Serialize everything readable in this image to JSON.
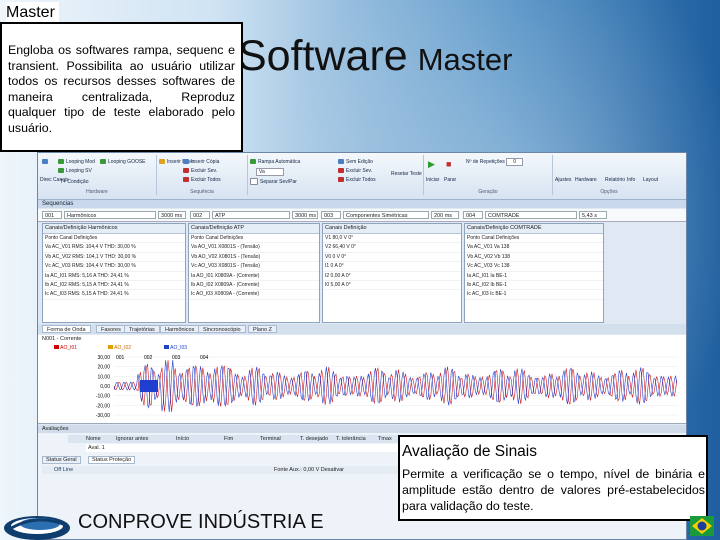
{
  "slide": {
    "title_main": "Software",
    "title_secondary": "Master"
  },
  "callout_master": {
    "heading": "Master",
    "body": "Engloba os softwares rampa, sequenc e transient. Possibilita ao usuário utilizar todos os recursos desses softwares de maneira centralizada, Reproduz qualquer tipo de teste elaborado pelo usuário."
  },
  "callout_avaliacao": {
    "heading": "Avaliação de Sinais",
    "body": "Permite a verificação se o tempo, nível de binária e amplitude estão dentro de valores pré-estabelecidos para validação do teste."
  },
  "footer": {
    "company": "CONPROVE INDÚSTRIA E"
  },
  "screenshot": {
    "ribbon": {
      "btn_looping1": "Looping Mod",
      "btn_looping2": "Looping GOOSE",
      "btn_looping3": "Looping SV",
      "btn_sinal": "Sinal Constante",
      "btn_direc": "Direc Canais",
      "btn_tabela": "T+ Condição",
      "btn_inserir": "Inserir Novo",
      "btn_inserir_copia": "Inserir Cópia",
      "btn_excluir_sev": "Excluir Sev.",
      "btn_excluir_todos": "Excluir Todos",
      "btn_rampa": "Rampa Automática",
      "btn_va": "Va",
      "btn_separar": "Separar Sev/Par",
      "btn_sem_edicao": "Sem Edição",
      "btn_excluir_sev2": "Excluir Sev.",
      "btn_excluir_todos2": "Excluir Todos",
      "btn_resetar": "Resetar Teste",
      "btn_iniciar": "Iniciar",
      "btn_parar": "Parar",
      "repeticoes_label": "Nº de Repetições",
      "repeticoes_value": "0",
      "btn_ajustes": "Ajustes",
      "btn_hardware": "Hardware",
      "btn_relatorio": "Relatório",
      "btn_info": "Info",
      "btn_layout": "Layout",
      "grp_hardware": "Hardware",
      "grp_sequencia": "Sequência",
      "grp_geracao": "Geração",
      "grp_opcoes": "Opções"
    },
    "tab_sequencias": "Sequencias",
    "seq": {
      "c1": "001",
      "c2": "Harmônicos",
      "c3": "3000 ms",
      "c4": "002",
      "c5": "ATP",
      "c6": "3000 ms",
      "c7": "003",
      "c8": "Componentes Simétricas",
      "c9": "200 ms",
      "c10": "004",
      "c11": "COMTRADE",
      "c12": "5,43 s"
    },
    "panels": {
      "p1_header": "Canais/Definição   Harmônicos",
      "p1_rows": [
        "Ponto  Canal   Definições",
        "Va   AC_V01   RMS: 104,4 V  THD: 30,00 %",
        "Vb   AC_V02   RMS: 104,1 V  THD: 30,00 %",
        "Vc   AC_V03   RMS: 104,4 V  THD: 30,00 %",
        "Ia   AC_I01   RMS: 5,16 A  THD: 24,41 %",
        "Ib   AC_I02   RMS: 5,15 A  THD: 24,41 %",
        "Ic   AC_I03   RMS: 5,15 A  THD: 24,41 %"
      ],
      "p2_header": "Canais/Definição   ATP",
      "p2_rows": [
        "Ponto  Canal   Definições",
        "Va   AO_V01   X0801S - (Tensão)",
        "Vb   AO_V02   X0801S - (Tensão)",
        "Vc   AO_V03   X0801S - (Tensão)",
        "Ia   AO_I01   X0809A - (Corrente)",
        "Ib   AO_I02   X0809A - (Corrente)",
        "Ic   AO_I03   X0809A - (Corrente)"
      ],
      "p3_header": "Canais  Definição",
      "p3_rows": [
        "V1   80,0 V   0°",
        "V2   66,40 V  0°",
        "V0   0 V   0°",
        "I1   0 A   0°",
        "I2   0,00 A  0°",
        "I0   5,00 A  0°"
      ],
      "p4_header": "Canais/Definição   COMTRADE",
      "p4_rows": [
        "Ponto  Canal  Definições",
        "Va   AC_V01   Va 138",
        "Vb   AC_V02   Vb 138",
        "Vc   AC_V03   Vc 138",
        "Ia   AC_I01   Ia BE-1",
        "Ib   AC_I02   Ib BE-1",
        "Ic   AC_I03   Ic BE-1"
      ]
    },
    "wave_tabs": [
      "Forma de Onda",
      "Fasores",
      "Trajetórias",
      "Harmônicos",
      "Sincronoscópio",
      "Plano Z"
    ],
    "wave": {
      "signal_label": "N001 - Corrente",
      "legend": [
        "AO_I01",
        "AO_I02",
        "AO_I03"
      ],
      "yticks": [
        "30,00",
        "20,00",
        "10,00",
        "0,00",
        "-10,00",
        "-20,00",
        "-30,00"
      ],
      "markers": [
        "001",
        "002",
        "003",
        "004"
      ]
    },
    "grid": {
      "section": "Avaliações",
      "columns": [
        "Nome",
        "Ignorar antes",
        "Início",
        "Fim",
        "Terminal",
        "T. desejado",
        "T. tolerância",
        "Tmax"
      ],
      "row_name": "Aval. 1"
    },
    "status_tabs": [
      "Status Geral",
      "Status Proteção"
    ],
    "status_left": "Off Line",
    "status_right": "Fonte Aux.: 0,00 V   Desativar"
  },
  "colors": {
    "wave_blue": "#1f3fd0",
    "wave_red": "#d01818",
    "background_dark": "#1f5f9f"
  }
}
